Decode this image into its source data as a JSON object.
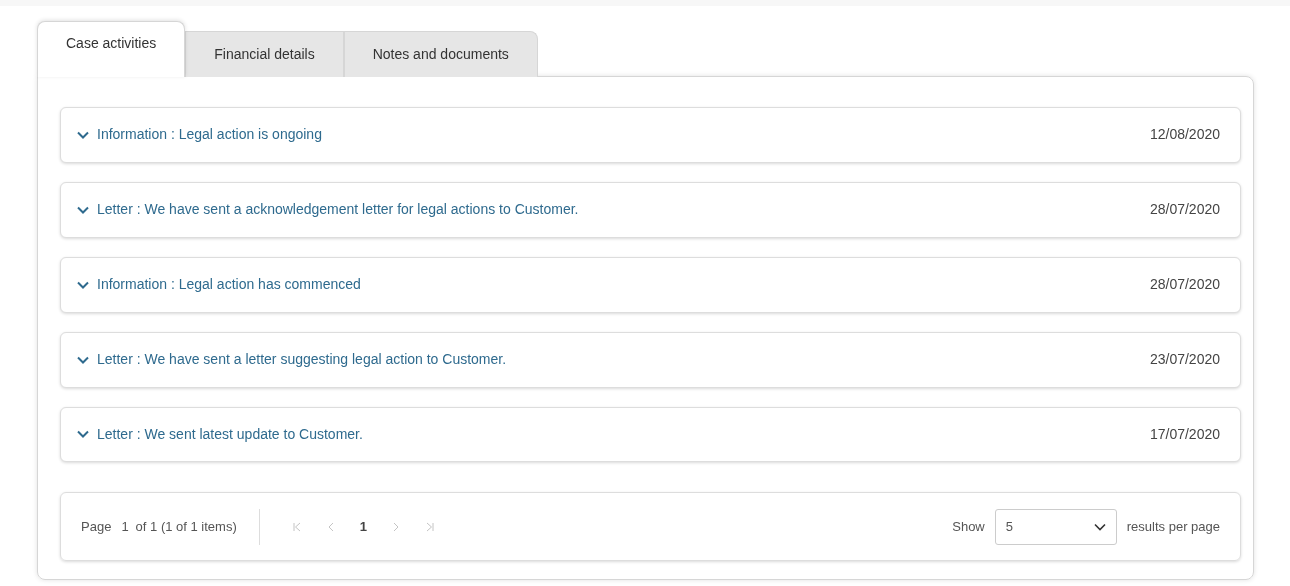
{
  "tabs": [
    {
      "label": "Case activities",
      "selected": true
    },
    {
      "label": "Financial details",
      "selected": false
    },
    {
      "label": "Notes and documents",
      "selected": false
    }
  ],
  "activities": [
    {
      "title": "Information : Legal action is ongoing",
      "date": "12/08/2020"
    },
    {
      "title": "Letter : We have sent a acknowledgement letter for legal actions to Customer.",
      "date": "28/07/2020"
    },
    {
      "title": "Information : Legal action has commenced",
      "date": "28/07/2020"
    },
    {
      "title": "Letter : We have sent a letter suggesting legal action to Customer.",
      "date": "23/07/2020"
    },
    {
      "title": "Letter : We sent latest update to Customer.",
      "date": "17/07/2020"
    }
  ],
  "pager": {
    "page_label": "Page",
    "page": "1",
    "summary": "of 1 (1 of 1 items)",
    "controls": [
      {
        "kind": "first",
        "disabled": true
      },
      {
        "kind": "prev",
        "disabled": true
      },
      {
        "kind": "page",
        "label": "1",
        "selected": true
      },
      {
        "kind": "next",
        "disabled": true
      },
      {
        "kind": "last",
        "disabled": true
      }
    ],
    "show_label": "Show",
    "page_size": "5",
    "per_page_label": "results per page"
  }
}
